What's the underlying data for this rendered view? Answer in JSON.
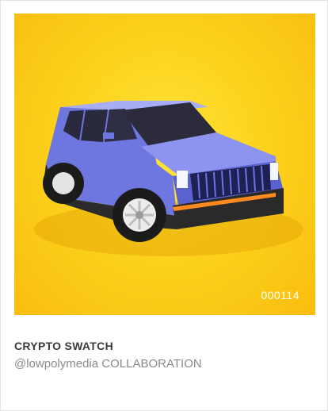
{
  "card": {
    "token_id": "000114",
    "title": "CRYPTO SWATCH",
    "subtitle": "@lowpolymedia COLLABORATION"
  },
  "artwork": {
    "subject": "low-poly blue SUV",
    "background_color": "#fcd31d",
    "vehicle_color": "#7f86ec"
  }
}
